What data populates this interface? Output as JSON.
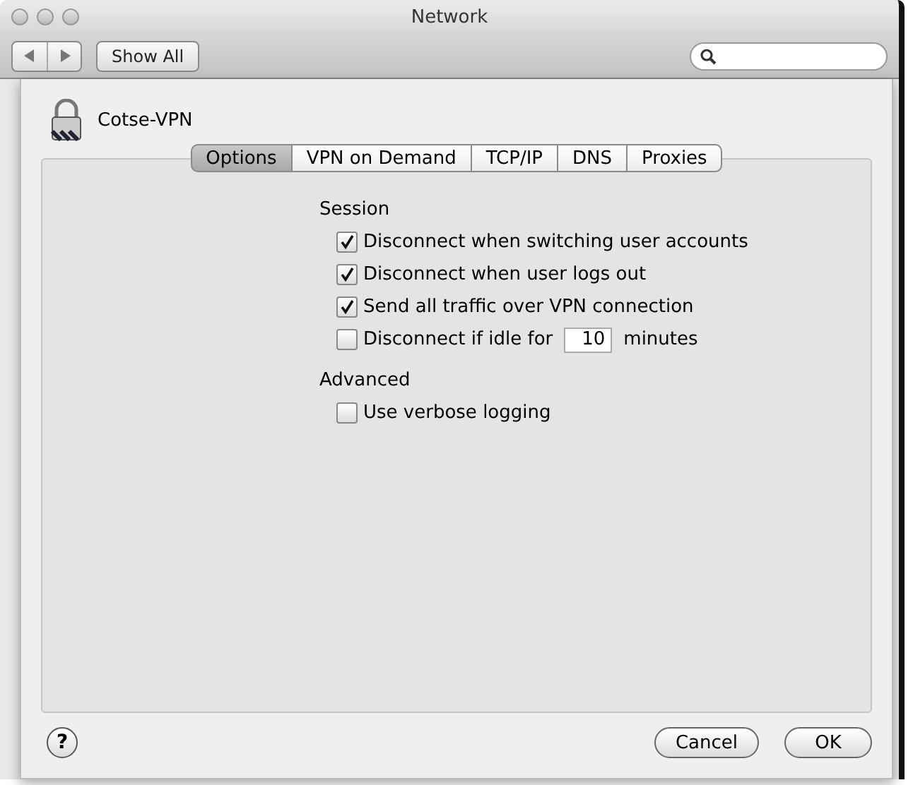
{
  "window": {
    "title": "Network"
  },
  "toolbar": {
    "show_all": "Show All"
  },
  "sheet": {
    "title": "Cotse-VPN",
    "tabs": [
      {
        "label": "Options",
        "selected": true
      },
      {
        "label": "VPN on Demand",
        "selected": false
      },
      {
        "label": "TCP/IP",
        "selected": false
      },
      {
        "label": "DNS",
        "selected": false
      },
      {
        "label": "Proxies",
        "selected": false
      }
    ],
    "sections": [
      {
        "title": "Session",
        "items": [
          {
            "kind": "checkbox",
            "label": "Disconnect when switching user accounts",
            "checked": true
          },
          {
            "kind": "checkbox",
            "label": "Disconnect when user logs out",
            "checked": true
          },
          {
            "kind": "checkbox",
            "label": "Send all traffic over VPN connection",
            "checked": true
          },
          {
            "kind": "checkbox-field",
            "label": "Disconnect if idle for",
            "value": "10",
            "unit": "minutes",
            "checked": false
          }
        ]
      },
      {
        "title": "Advanced",
        "items": [
          {
            "kind": "checkbox",
            "label": "Use verbose logging",
            "checked": false
          }
        ]
      }
    ],
    "help": "?",
    "buttons": [
      {
        "label": "Cancel"
      },
      {
        "label": "OK"
      }
    ]
  }
}
